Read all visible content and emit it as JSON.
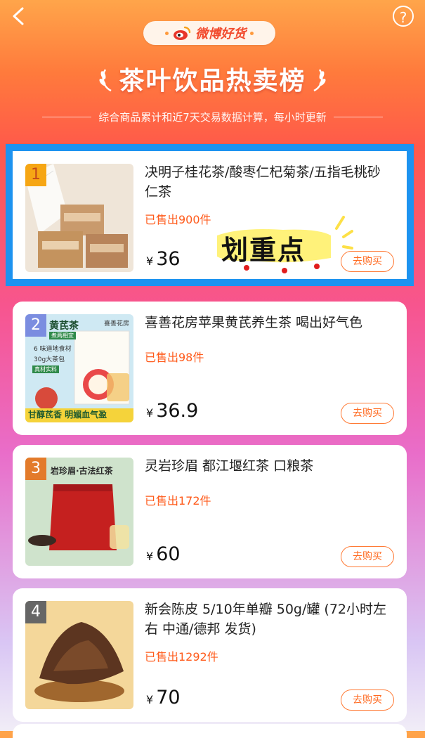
{
  "header": {
    "brand": "微博好货",
    "title": "茶叶饮品热卖榜",
    "subtitle": "综合商品累计和近7天交易数据计算，每小时更新",
    "help_label": "?"
  },
  "sticker_text": "划重点",
  "currency_symbol": "¥",
  "buy_label": "去购买",
  "products": [
    {
      "rank": "1",
      "name": "决明子桂花茶/酸枣仁杞菊茶/五指毛桃砂仁茶",
      "sold": "已售出900件",
      "price": "36"
    },
    {
      "rank": "2",
      "name": "喜善花房苹果黄芪养生茶 喝出好气色",
      "sold": "已售出98件",
      "price": "36.9",
      "thumb": {
        "badge": "黄芪茶",
        "tag": "煮两相宜",
        "brand": "喜善花房",
        "line1": "6 味道地食材",
        "line2": "30g大茶包",
        "tag2": "真材实料",
        "slogan": "甘醇芪香 明媚血气盈"
      }
    },
    {
      "rank": "3",
      "name": "灵岩珍眉 都江堰红茶 口粮茶",
      "sold": "已售出172件",
      "price": "60",
      "thumb": {
        "header": "岩珍眉·古法红茶"
      }
    },
    {
      "rank": "4",
      "name": "新会陈皮 5/10年单瓣 50g/罐 (72小时左右 中通/德邦 发货)",
      "sold": "已售出1292件",
      "price": "70"
    }
  ],
  "colors": {
    "accent": "#ff5a1a",
    "highlight_border": "#1d93f0",
    "title_white": "#ffffff"
  }
}
